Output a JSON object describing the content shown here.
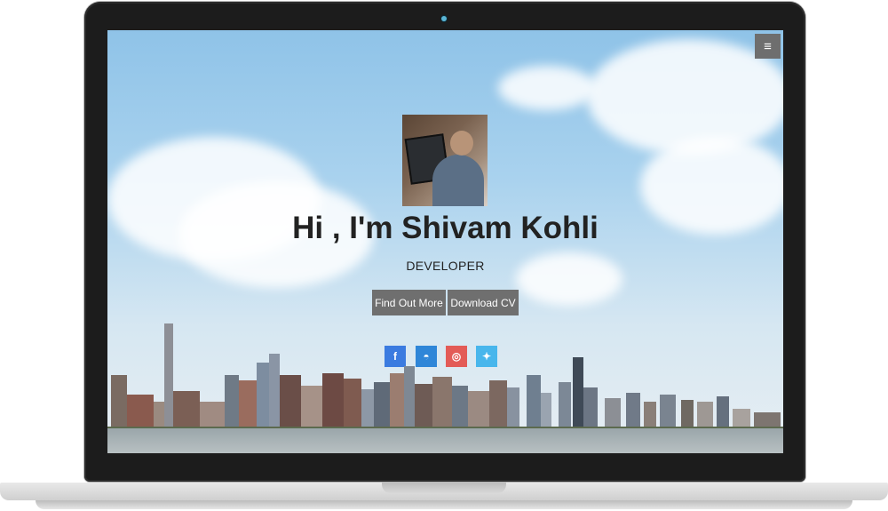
{
  "hero": {
    "title": "Hi , I'm Shivam Kohli",
    "subtitle": "DEVELOPER"
  },
  "buttons": {
    "find_out_more": "Find Out More",
    "download_cv": "Download CV"
  },
  "menu": {
    "icon": "hamburger-menu-icon",
    "glyph": "≡"
  },
  "social": [
    {
      "name": "facebook-icon",
      "glyph": "f",
      "color": "#3b7be0"
    },
    {
      "name": "github-icon",
      "glyph": "◓",
      "color": "#2f86d8"
    },
    {
      "name": "instagram-icon",
      "glyph": "◎",
      "color": "#e35b57"
    },
    {
      "name": "twitter-icon",
      "glyph": "✦",
      "color": "#48b6ec"
    }
  ]
}
